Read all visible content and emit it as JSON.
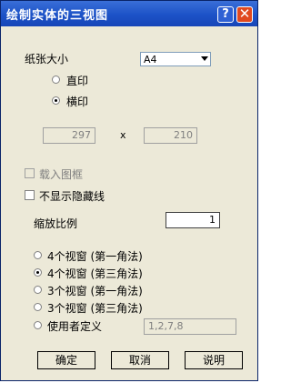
{
  "window": {
    "title": "绘制实体的三视图",
    "help_label": "?",
    "close_label": "✕"
  },
  "paper": {
    "size_label": "纸张大小",
    "size_value": "A4",
    "portrait_label": "直印",
    "landscape_label": "横印",
    "selected_orientation": "landscape",
    "width": "297",
    "x_label": "x",
    "height": "210"
  },
  "options": {
    "load_frame_label": "载入图框",
    "load_frame_checked": false,
    "load_frame_enabled": false,
    "hide_hidden_label": "不显示隐藏线",
    "hide_hidden_checked": false
  },
  "scale": {
    "label": "缩放比例",
    "value": "1"
  },
  "views": {
    "items": [
      {
        "label": "4个视窗 (第一角法)",
        "selected": false
      },
      {
        "label": "4个视窗 (第三角法)",
        "selected": true
      },
      {
        "label": "3个视窗 (第一角法)",
        "selected": false
      },
      {
        "label": "3个视窗 (第三角法)",
        "selected": false
      },
      {
        "label": "使用者定义",
        "selected": false
      }
    ],
    "custom_value": "1,2,7,8"
  },
  "buttons": {
    "ok": "确定",
    "cancel": "取消",
    "help": "说明"
  }
}
